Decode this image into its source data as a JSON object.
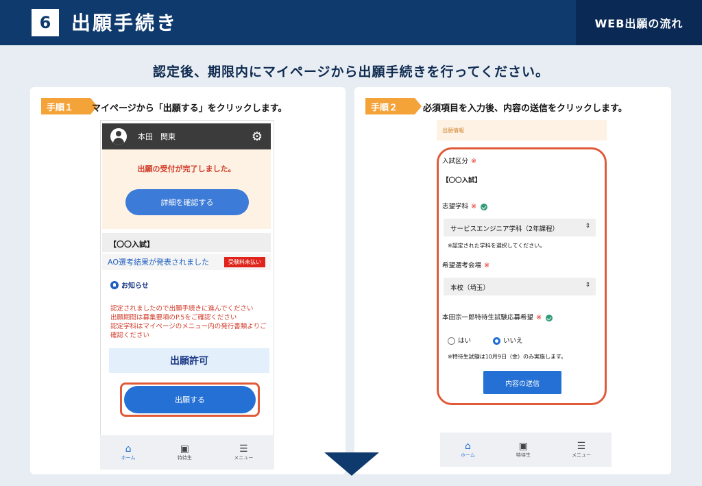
{
  "header": {
    "step_number": "6",
    "title": "出願手続き",
    "right_label": "WEB出願の流れ"
  },
  "subtitle": "認定後、期限内にマイページから出願手続きを行ってください。",
  "step1": {
    "tag": "手順１",
    "instruction": "マイページから「出願する」をクリックします。",
    "user_name": "本田　関東",
    "receipt_done": "出願の受付が完了しました。",
    "detail_button": "詳細を確認する",
    "exam_name": "【〇〇入試】",
    "ao_result": "AO選考結果が発表されました",
    "unpaid_badge": "受験料未払い",
    "notice_label": "お知らせ",
    "message_lines": [
      "認定されましたので出願手続きに進んでください",
      "出願期間は募集要項のP.5をご確認ください",
      "認定学科はマイページのメニュー内の発行書類よりご確認ください"
    ],
    "permit": "出願許可",
    "apply_button": "出願する"
  },
  "step2": {
    "tag": "手順２",
    "instruction": "必須項目を入力後、内容の送信をクリックします。",
    "section_header": "出願情報",
    "exam_type_label": "入試区分",
    "required_mark": "※",
    "exam_type_value": "【〇〇入試】",
    "dept_label": "志望学科",
    "dept_value": "サービスエンジニア学科（2年課程）",
    "dept_note": "※認定された学科を選択してください。",
    "venue_label": "希望選考会場",
    "venue_value": "本校（埼玉）",
    "scholarship_label": "本田宗一郎特待生試験応募希望",
    "yes": "はい",
    "no": "いいえ",
    "scholarship_note": "※特待生試験は10月9日（金）のみ実施します。",
    "submit_button": "内容の送信"
  },
  "tabbar": {
    "home": "ホーム",
    "special": "特待生",
    "menu": "メニュー"
  },
  "icons": {
    "home": "home-icon",
    "card": "id-card-icon",
    "menu": "hamburger-icon",
    "gear": "gear-icon",
    "bell": "bell-icon"
  },
  "colors": {
    "navy": "#0f3a6e",
    "orange": "#f4a338",
    "red": "#e0241b",
    "blue": "#2470d4"
  }
}
